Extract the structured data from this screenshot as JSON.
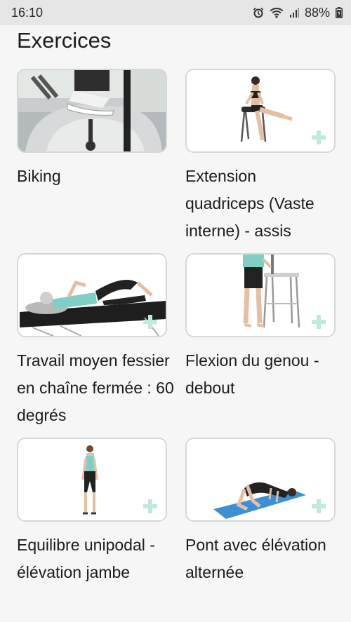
{
  "status_bar": {
    "time": "16:10",
    "battery": "88%"
  },
  "page": {
    "title": "Exercices"
  },
  "exercises": [
    {
      "label": "Biking"
    },
    {
      "label": "Extension quadriceps (Vaste interne) - assis"
    },
    {
      "label": "Travail moyen fessier en chaîne fermée : 60 degrés"
    },
    {
      "label": "Flexion du genou - debout"
    },
    {
      "label": "Equilibre unipodal - élévation jambe"
    },
    {
      "label": "Pont avec élévation alternée"
    }
  ],
  "icons": {
    "alarm": "alarm-icon",
    "wifi": "wifi-icon",
    "signal": "signal-icon",
    "battery": "battery-icon",
    "add": "plus-icon"
  },
  "colors": {
    "plus_accent": "#bfe9df",
    "card_border": "#d5d8d6"
  }
}
